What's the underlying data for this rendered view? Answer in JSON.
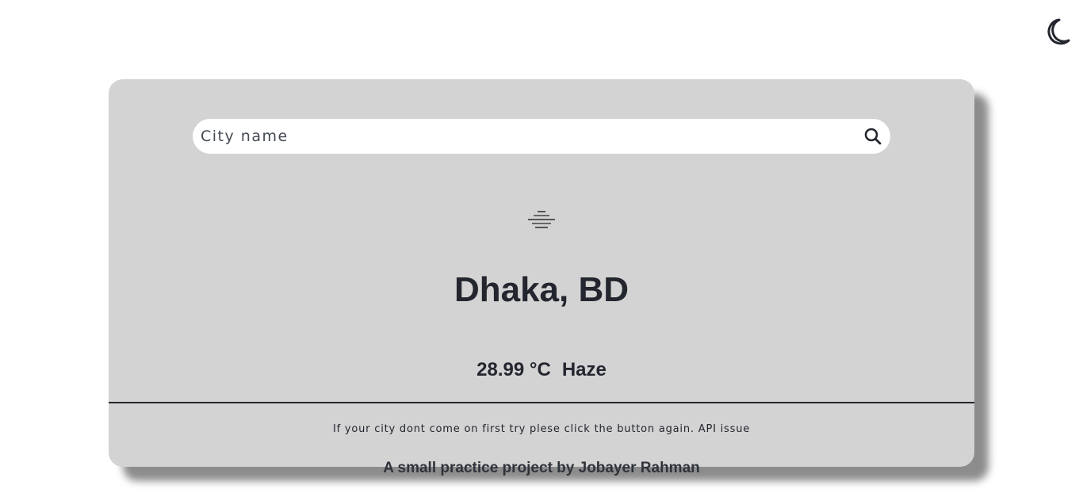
{
  "header": {
    "theme_toggle_icon": "moon-icon"
  },
  "search": {
    "placeholder": "City name",
    "value": "",
    "button_icon": "search-icon"
  },
  "weather": {
    "icon": "haze-icon",
    "location": "Dhaka, BD",
    "temperature": "28.99 °C",
    "condition": "Haze"
  },
  "footer": {
    "notice": "If your city dont come on first try plese click the button again. API issue",
    "credit": "A small practice project by Jobayer Rahman"
  },
  "colors": {
    "background": "#ffffff",
    "card": "#d3d3d3",
    "text": "#23262e",
    "input_background": "#ffffff"
  }
}
